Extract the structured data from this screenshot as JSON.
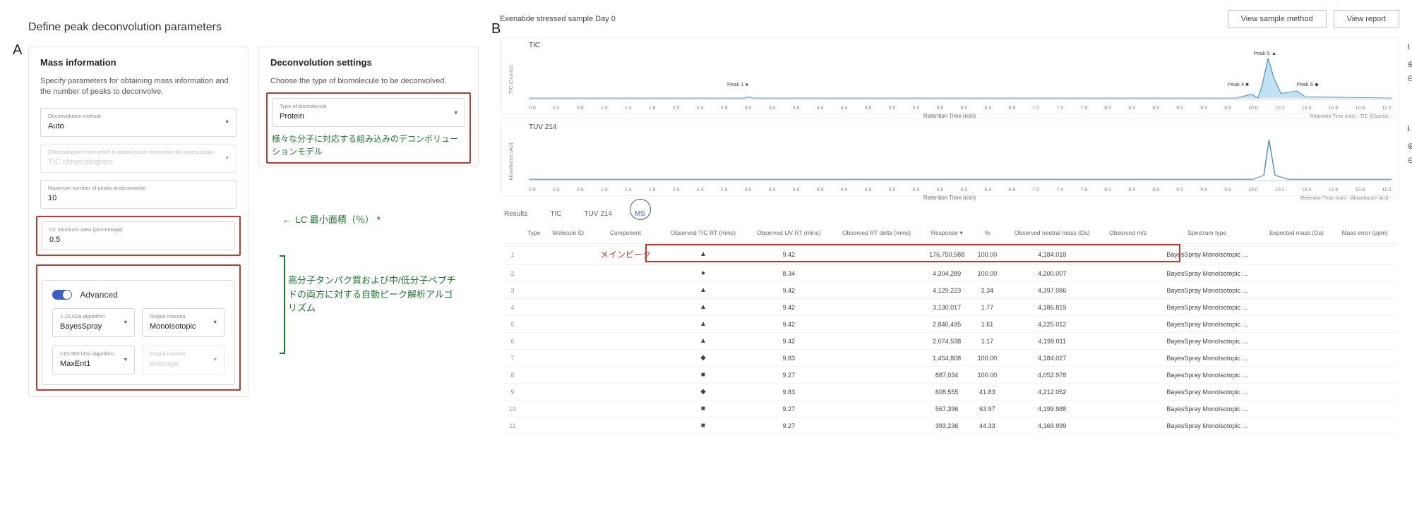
{
  "labels": {
    "A": "A",
    "B": "B"
  },
  "panelA": {
    "title": "Define peak deconvolution parameters",
    "mass": {
      "heading": "Mass information",
      "subtitle": "Specify parameters for obtaining mass information and the number of peaks to deconvolve.",
      "deconvolution_method_label": "Deconvolution method",
      "deconvolution_method_value": "Auto",
      "chromatogram_label": "Chromatogram from which to obtain mass information for largest peaks",
      "chromatogram_value": "TIC chromatogram",
      "max_peaks_label": "Maximum number of peaks to deconvolve",
      "max_peaks_value": "10",
      "lc_min_area_label": "LC minimum area (percentage)",
      "lc_min_area_value": "0.5"
    },
    "deconv": {
      "heading": "Deconvolution settings",
      "subtitle": "Choose the type of biomolecule to be deconvolved.",
      "biomolecule_label": "Type of biomolecule",
      "biomolecule_value": "Protein"
    },
    "annotations": {
      "biomolecule_note": "様々な分子に対応する組み込みのデコンボリューションモデル",
      "lc_note": "LC 最小面積（％）",
      "lc_note_asterisk": "*",
      "adv_note": "高分子タンパク質および中/低分子ペプチドの両方に対する自動ピーク解析アルゴリズム"
    },
    "advanced": {
      "toggle_label": "Advanced",
      "algo1_label": "1-15 kDa algorithm",
      "algo1_value": "BayesSpray",
      "out1_label": "Output masses",
      "out1_value": "MonoIsotopic",
      "algo2_label": ">15-300 kDa algorithm",
      "algo2_value": "MaxEnt1",
      "out2_label": "Output masses",
      "out2_value": "Average"
    }
  },
  "panelB": {
    "sample_title": "Exenatide stressed sample Day 0",
    "buttons": {
      "view_method": "View sample method",
      "view_report": "View report"
    },
    "tic": {
      "label": "TIC",
      "y_axis": "TIC (Counts)",
      "x_axis": "Retention Time (min)",
      "legend": "Retention Time (min) -   TIC (Counts) -",
      "ticks": [
        "0.0",
        "0.4",
        "0.8",
        "1.0",
        "1.4",
        "1.8",
        "2.0",
        "2.4",
        "2.8",
        "3.0",
        "3.4",
        "3.8",
        "4.0",
        "4.4",
        "4.8",
        "5.0",
        "5.4",
        "5.8",
        "6.0",
        "6.4",
        "6.8",
        "7.0",
        "7.4",
        "7.8",
        "8.0",
        "8.4",
        "8.8",
        "9.0",
        "9.4",
        "9.8",
        "10.0",
        "10.2",
        "10.4",
        "10.6",
        "10.8",
        "11.0"
      ],
      "peaks": {
        "p1": "Peak 1 ●",
        "p4": "Peak 4 ■",
        "p5": "Peak 5 ▲",
        "p6": "Peak 6 ◆"
      }
    },
    "tuv": {
      "label": "TUV 214",
      "y_axis": "Absorbance (AU)",
      "x_axis": "Retention Time (min)",
      "legend": "Retention Time (min) -   Absorbance (AU) -",
      "ticks": [
        "0.0",
        "0.4",
        "0.8",
        "1.0",
        "1.4",
        "1.8",
        "2.0",
        "2.4",
        "2.8",
        "3.0",
        "3.4",
        "3.8",
        "4.0",
        "4.4",
        "4.8",
        "5.0",
        "5.4",
        "5.8",
        "6.0",
        "6.4",
        "6.8",
        "7.0",
        "7.4",
        "7.8",
        "8.0",
        "8.4",
        "8.8",
        "9.0",
        "9.4",
        "9.8",
        "10.0",
        "10.2",
        "10.4",
        "10.6",
        "10.8",
        "11.0"
      ]
    },
    "tabs": {
      "results": "Results",
      "tic": "TIC",
      "tuv": "TUV 214",
      "ms": "MS"
    },
    "table": {
      "cols": {
        "idx": "",
        "type": "Type",
        "mol_id": "Molecule ID",
        "component": "Component",
        "obs_tic_rt": "Observed TIC RT (mins)",
        "obs_uv_rt": "Observed UV RT (mins)",
        "obs_rt_delta": "Observed RT delta (mins)",
        "response": "Response ▾",
        "pct": "%",
        "obs_neutral": "Observed neutral mass (Da)",
        "obs_mz": "Observed m/z",
        "spectrum": "Spectrum type",
        "expected": "Expected mass (Da)",
        "mass_err": "Mass error (ppm)"
      },
      "main_peak_label": "メインピーク",
      "rows": [
        {
          "idx": "1",
          "type": "▲",
          "tic_rt": "9.42",
          "resp": "176,750,588",
          "pct": "100.00",
          "neutral": "4,184.018",
          "spectrum": "BayesSpray MonoIsotopic ..."
        },
        {
          "idx": "2",
          "type": "●",
          "tic_rt": "8.34",
          "resp": "4,304,289",
          "pct": "100.00",
          "neutral": "4,200.007",
          "spectrum": "BayesSpray MonoIsotopic ..."
        },
        {
          "idx": "3",
          "type": "▲",
          "tic_rt": "9.42",
          "resp": "4,129,223",
          "pct": "2.34",
          "neutral": "4,397.086",
          "spectrum": "BayesSpray MonoIsotopic ..."
        },
        {
          "idx": "4",
          "type": "▲",
          "tic_rt": "9.42",
          "resp": "3,130,017",
          "pct": "1.77",
          "neutral": "4,186.819",
          "spectrum": "BayesSpray MonoIsotopic ..."
        },
        {
          "idx": "5",
          "type": "▲",
          "tic_rt": "9.42",
          "resp": "2,840,495",
          "pct": "1.61",
          "neutral": "4,225.012",
          "spectrum": "BayesSpray MonoIsotopic ..."
        },
        {
          "idx": "6",
          "type": "▲",
          "tic_rt": "9.42",
          "resp": "2,074,538",
          "pct": "1.17",
          "neutral": "4,199.011",
          "spectrum": "BayesSpray MonoIsotopic ..."
        },
        {
          "idx": "7",
          "type": "◆",
          "tic_rt": "9.83",
          "resp": "1,454,808",
          "pct": "100.00",
          "neutral": "4,184.027",
          "spectrum": "BayesSpray MonoIsotopic ..."
        },
        {
          "idx": "8",
          "type": "■",
          "tic_rt": "9.27",
          "resp": "887,034",
          "pct": "100.00",
          "neutral": "4,052.978",
          "spectrum": "BayesSpray MonoIsotopic ..."
        },
        {
          "idx": "9",
          "type": "◆",
          "tic_rt": "9.83",
          "resp": "608,555",
          "pct": "41.83",
          "neutral": "4,212.052",
          "spectrum": "BayesSpray MonoIsotopic ..."
        },
        {
          "idx": "10",
          "type": "■",
          "tic_rt": "9.27",
          "resp": "567,396",
          "pct": "63.97",
          "neutral": "4,199.988",
          "spectrum": "BayesSpray MonoIsotopic ..."
        },
        {
          "idx": "11",
          "type": "■",
          "tic_rt": "9.27",
          "resp": "393,236",
          "pct": "44.33",
          "neutral": "4,169.999",
          "spectrum": "BayesSpray MonoIsotopic ..."
        }
      ]
    }
  },
  "chart_data": [
    {
      "type": "line",
      "title": "TIC",
      "xlabel": "Retention Time (min)",
      "ylabel": "TIC (Counts)",
      "xlim": [
        0,
        11
      ],
      "series": [
        {
          "name": "TIC",
          "x": [
            0,
            2.8,
            8.34,
            9.0,
            9.27,
            9.42,
            9.6,
            9.83,
            10.2,
            11
          ],
          "y": [
            0,
            0,
            0.05,
            0.02,
            0.08,
            1.0,
            0.15,
            0.1,
            0.02,
            0
          ]
        }
      ],
      "annotations": [
        {
          "x": 2.8,
          "text": "Peak 1 ●"
        },
        {
          "x": 9.27,
          "text": "Peak 4 ■"
        },
        {
          "x": 9.42,
          "text": "Peak 5 ▲"
        },
        {
          "x": 9.83,
          "text": "Peak 6 ◆"
        }
      ]
    },
    {
      "type": "line",
      "title": "TUV 214",
      "xlabel": "Retention Time (min)",
      "ylabel": "Absorbance (AU)",
      "xlim": [
        0,
        11
      ],
      "series": [
        {
          "name": "TUV 214",
          "x": [
            0,
            9.1,
            9.3,
            9.42,
            9.55,
            9.8,
            11
          ],
          "y": [
            0,
            0,
            0.05,
            1.0,
            0.05,
            0,
            0
          ]
        }
      ]
    }
  ]
}
